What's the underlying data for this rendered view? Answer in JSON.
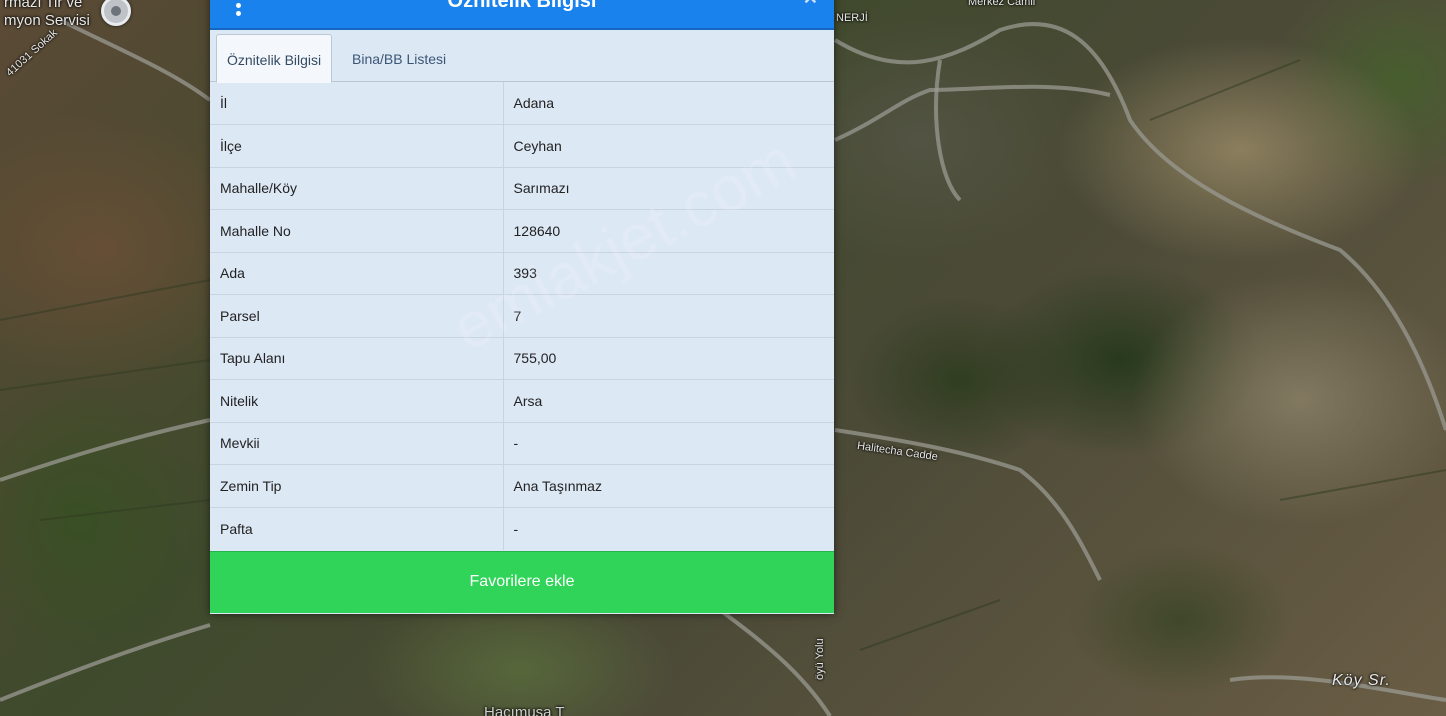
{
  "map": {
    "labels": {
      "top_left_1": "rmazı Tir ve",
      "top_left_2": "myon Servisi",
      "street_sokak": "41031 Sokak",
      "top_right_mosque": "Merkez Camii",
      "top_enerji": "NERJİ",
      "road_right_bottom": "Köy Sr.",
      "road_vertical": "öyü Yolu",
      "bottom_center": "Hacımusa T",
      "middle_street": "Halitecha Cadde"
    }
  },
  "dialog": {
    "title": "Öznitelik Bilgisi",
    "tabs": [
      {
        "label": "Öznitelik Bilgisi",
        "active": true
      },
      {
        "label": "Bina/BB Listesi",
        "active": false
      }
    ],
    "rows": [
      {
        "key": "İl",
        "value": "Adana"
      },
      {
        "key": "İlçe",
        "value": "Ceyhan"
      },
      {
        "key": "Mahalle/Köy",
        "value": "Sarımazı"
      },
      {
        "key": "Mahalle No",
        "value": "128640"
      },
      {
        "key": "Ada",
        "value": "393"
      },
      {
        "key": "Parsel",
        "value": "7"
      },
      {
        "key": "Tapu Alanı",
        "value": "755,00"
      },
      {
        "key": "Nitelik",
        "value": "Arsa"
      },
      {
        "key": "Mevkii",
        "value": "-"
      },
      {
        "key": "Zemin Tip",
        "value": "Ana Taşınmaz"
      },
      {
        "key": "Pafta",
        "value": "-"
      }
    ],
    "favorite_button": "Favorilere ekle",
    "header_color": "#1a82ec",
    "button_color": "#2fd459"
  },
  "watermark": "emlakjet.com"
}
